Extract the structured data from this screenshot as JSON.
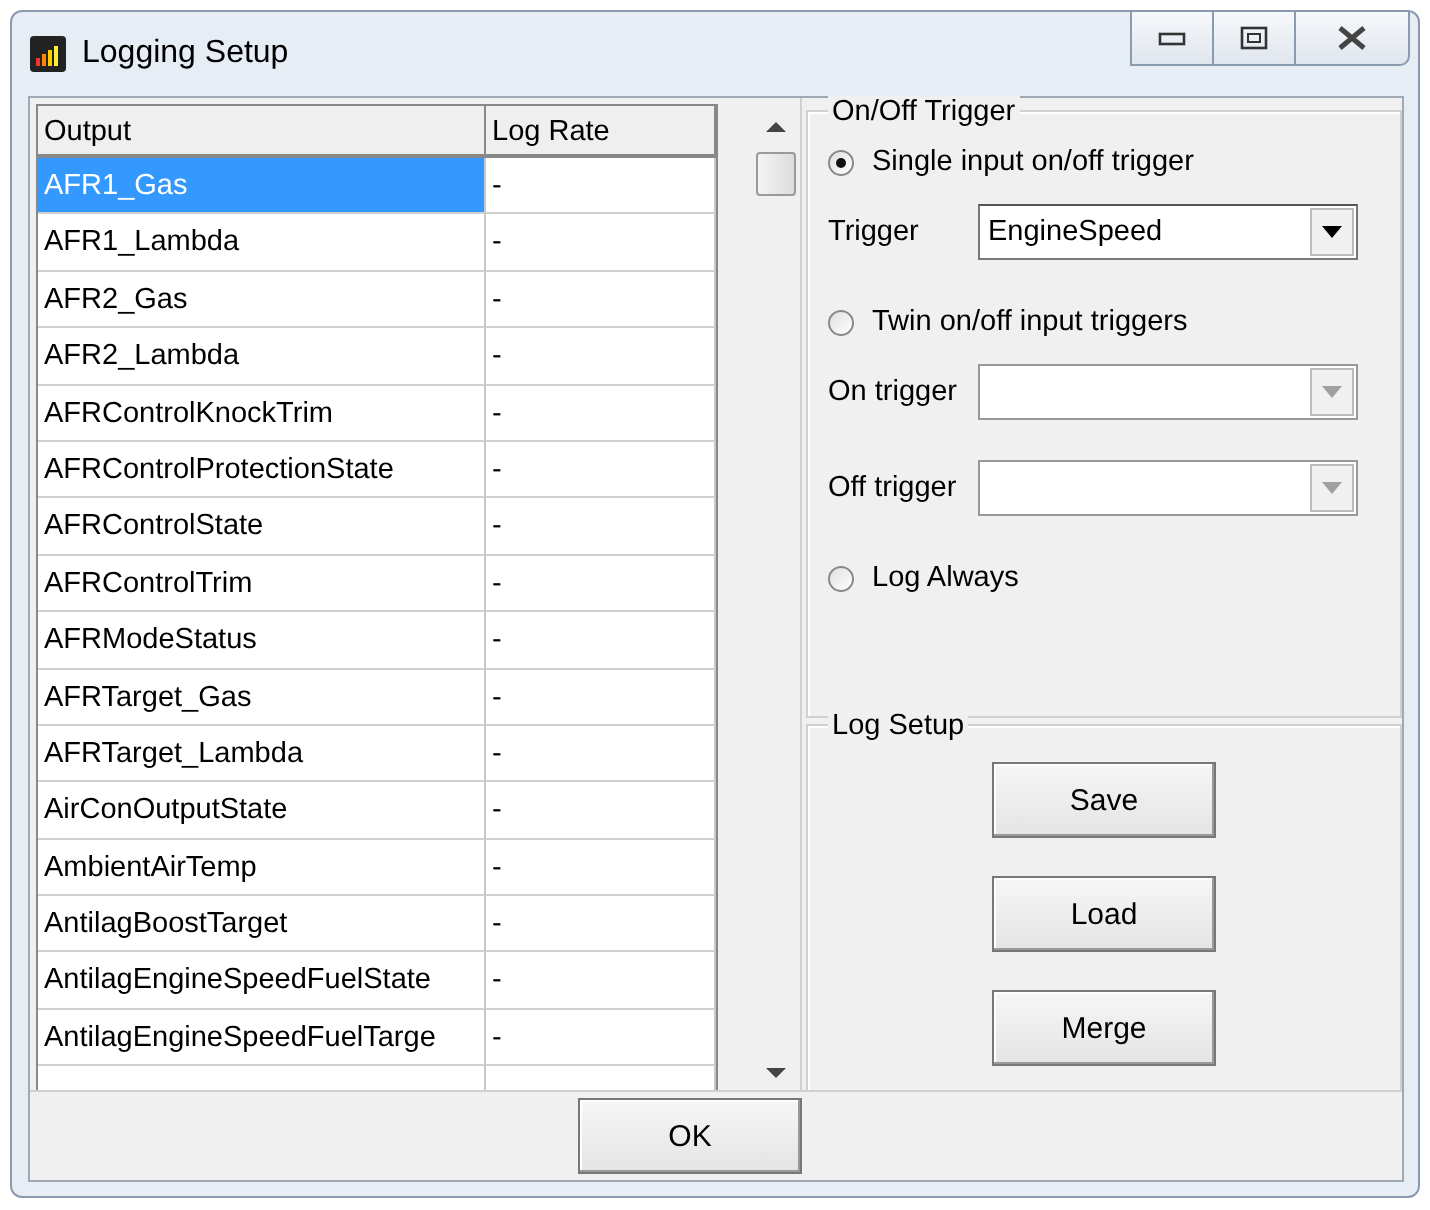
{
  "window": {
    "title": "Logging Setup"
  },
  "table": {
    "columns": [
      "Output",
      "Log Rate"
    ],
    "rows": [
      {
        "output": "AFR1_Gas",
        "log_rate": "-",
        "selected": true
      },
      {
        "output": "AFR1_Lambda",
        "log_rate": "-",
        "selected": false
      },
      {
        "output": "AFR2_Gas",
        "log_rate": "-",
        "selected": false
      },
      {
        "output": "AFR2_Lambda",
        "log_rate": "-",
        "selected": false
      },
      {
        "output": "AFRControlKnockTrim",
        "log_rate": "-",
        "selected": false
      },
      {
        "output": "AFRControlProtectionState",
        "log_rate": "-",
        "selected": false
      },
      {
        "output": "AFRControlState",
        "log_rate": "-",
        "selected": false
      },
      {
        "output": "AFRControlTrim",
        "log_rate": "-",
        "selected": false
      },
      {
        "output": "AFRModeStatus",
        "log_rate": "-",
        "selected": false
      },
      {
        "output": "AFRTarget_Gas",
        "log_rate": "-",
        "selected": false
      },
      {
        "output": "AFRTarget_Lambda",
        "log_rate": "-",
        "selected": false
      },
      {
        "output": "AirConOutputState",
        "log_rate": "-",
        "selected": false
      },
      {
        "output": "AmbientAirTemp",
        "log_rate": "-",
        "selected": false
      },
      {
        "output": "AntilagBoostTarget",
        "log_rate": "-",
        "selected": false
      },
      {
        "output": "AntilagEngineSpeedFuelState",
        "log_rate": "-",
        "selected": false
      },
      {
        "output": "AntilagEngineSpeedFuelTarge",
        "log_rate": "-",
        "selected": false
      }
    ]
  },
  "trigger_group": {
    "title": "On/Off Trigger",
    "items": [
      {
        "kind": "radio",
        "label": "Single input on/off trigger",
        "selected": true
      },
      {
        "kind": "combo",
        "label": "Trigger",
        "value": "EngineSpeed",
        "disabled": false
      },
      {
        "kind": "radio",
        "label": "Twin on/off input triggers",
        "selected": false
      },
      {
        "kind": "combo",
        "label": "On trigger",
        "disabled": true
      },
      {
        "kind": "combo",
        "label": "Off trigger",
        "disabled": true
      },
      {
        "kind": "radio",
        "label": "Log Always",
        "selected": false
      }
    ]
  },
  "log_setup": {
    "title": "Log Setup",
    "buttons": [
      "Save",
      "Load",
      "Merge"
    ]
  },
  "ok_button": "OK"
}
